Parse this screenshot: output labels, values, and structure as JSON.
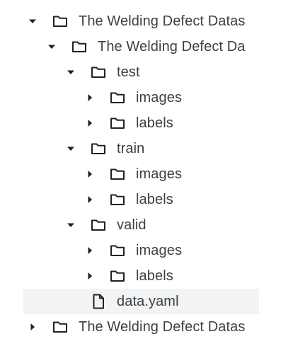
{
  "tree": {
    "rows": [
      {
        "label": "The Welding Defect Datas",
        "kind": "folder",
        "expanded": true,
        "level": 0
      },
      {
        "label": "The Welding Defect Da",
        "kind": "folder",
        "expanded": true,
        "level": 1
      },
      {
        "label": "test",
        "kind": "folder",
        "expanded": true,
        "level": 2
      },
      {
        "label": "images",
        "kind": "folder",
        "expanded": false,
        "level": 3
      },
      {
        "label": "labels",
        "kind": "folder",
        "expanded": false,
        "level": 3
      },
      {
        "label": "train",
        "kind": "folder",
        "expanded": true,
        "level": 2
      },
      {
        "label": "images",
        "kind": "folder",
        "expanded": false,
        "level": 3
      },
      {
        "label": "labels",
        "kind": "folder",
        "expanded": false,
        "level": 3
      },
      {
        "label": "valid",
        "kind": "folder",
        "expanded": true,
        "level": 2
      },
      {
        "label": "images",
        "kind": "folder",
        "expanded": false,
        "level": 3
      },
      {
        "label": "labels",
        "kind": "folder",
        "expanded": false,
        "level": 3
      },
      {
        "label": "data.yaml",
        "kind": "file",
        "selected": true,
        "level": 2
      },
      {
        "label": "The Welding Defect Datas",
        "kind": "folder",
        "expanded": false,
        "level": 0
      }
    ]
  },
  "icons": {
    "expanded": "caret-down-icon",
    "collapsed": "caret-right-icon",
    "folder": "folder-icon",
    "file": "file-icon"
  },
  "colors": {
    "text": "#3c4043",
    "icon": "#202124",
    "selected_bg": "#f1f3f4"
  }
}
